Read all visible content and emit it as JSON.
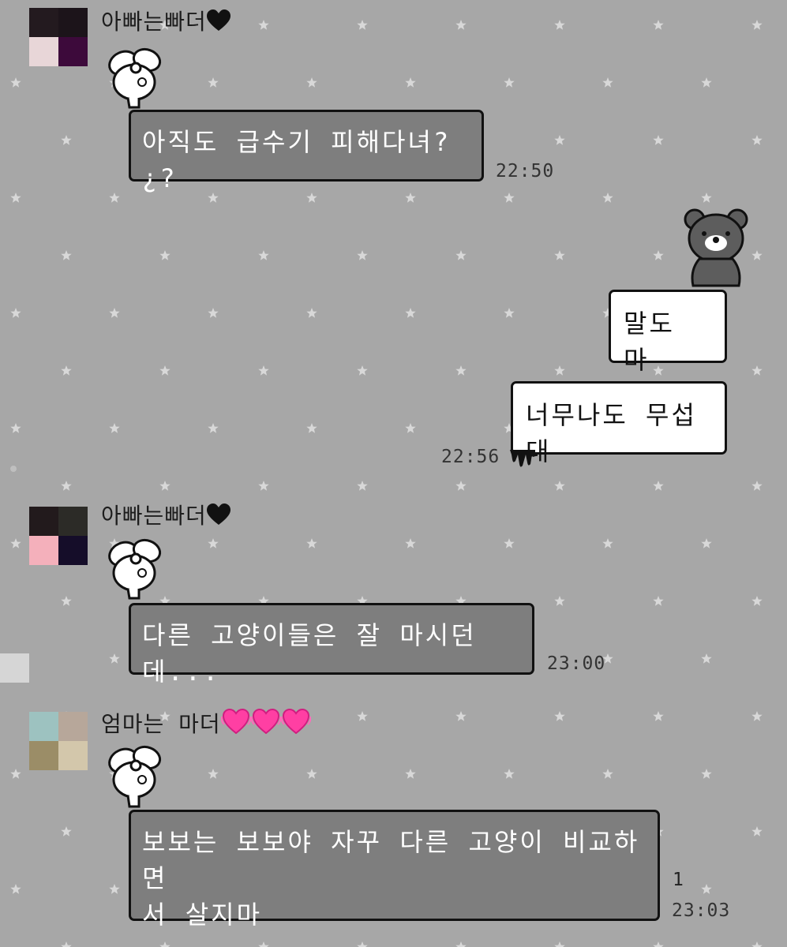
{
  "messages": [
    {
      "sender": "아빠는빠더",
      "text": "아직도 급수기 피해다녀?¿?",
      "time": "22:50"
    },
    {
      "text": "말도 마"
    },
    {
      "text": "너무나도 무섭대",
      "time": "22:56"
    },
    {
      "sender": "아빠는빠더",
      "text": "다른 고양이들은 잘 마시던데...",
      "time": "23:00"
    },
    {
      "sender": "엄마는 마더",
      "text": "보보는 보보야 자꾸 다른 고양이 비교하면\n서 살지마",
      "time": "23:03",
      "unread": "1"
    }
  ],
  "colors": {
    "background": "#a7a7a7",
    "star": "#d8d8d8",
    "incoming_bubble": "#7e7e7e",
    "outgoing_bubble": "#ffffff",
    "bubble_border": "#111111",
    "black_heart": "#111111",
    "pink_heart": "#ff3fa3"
  },
  "icons": {
    "black_heart": "black-heart-emoji",
    "pink_heart": "growing-pink-heart-emoji",
    "profile_decoration": "white-ribbon-bunny-sticker",
    "outgoing_decoration": "gray-bear-sticker",
    "timestamp_decoration": "black-drip-sticker"
  },
  "avatars": [
    [
      "#231a1f",
      "#1c141a",
      "#e8d6d8",
      "#3d0a3b"
    ],
    [
      "#221a1c",
      "#2c2b27",
      "#f4b0bb",
      "#150d29"
    ],
    [
      "#9dc2c0",
      "#b7a79a",
      "#9b8d67",
      "#d3c7ab"
    ]
  ]
}
